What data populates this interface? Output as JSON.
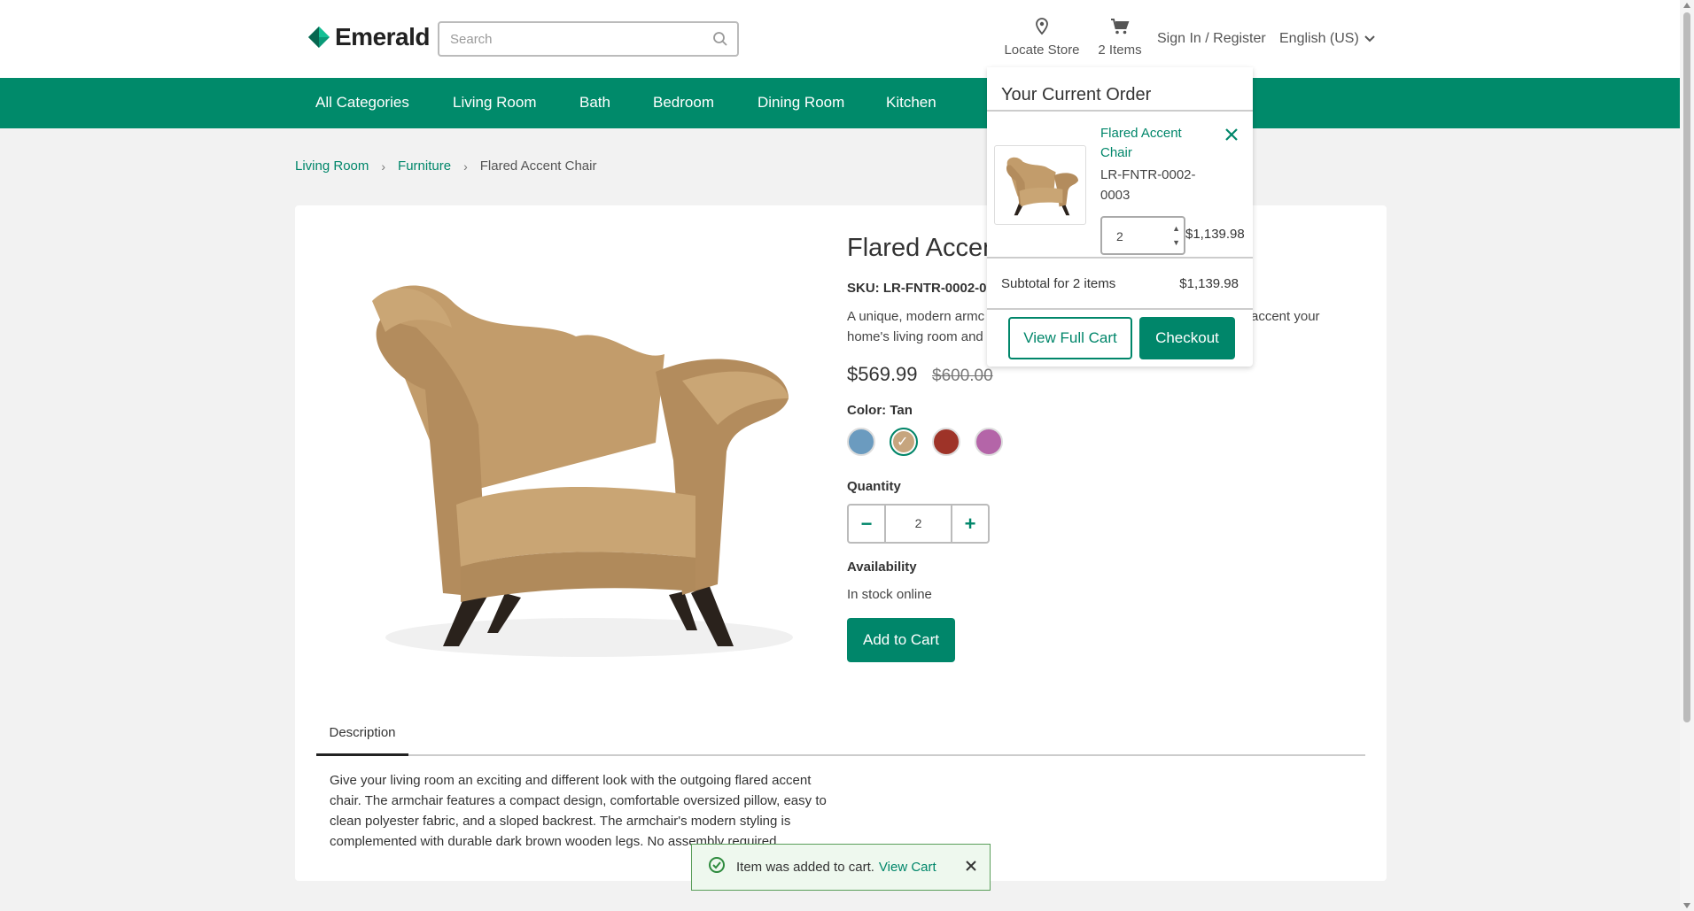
{
  "header": {
    "brand": "Emerald",
    "search_placeholder": "Search",
    "locate_store": "Locate Store",
    "cart_label": "2 Items",
    "sign_in": "Sign In / Register",
    "language": "English (US)"
  },
  "nav": {
    "items": [
      "All Categories",
      "Living Room",
      "Bath",
      "Bedroom",
      "Dining Room",
      "Kitchen"
    ]
  },
  "breadcrumb": {
    "items": [
      "Living Room",
      "Furniture",
      "Flared Accent Chair"
    ]
  },
  "product": {
    "title": "Flared Accen",
    "sku_label": "SKU: LR-FNTR-0002-00",
    "short_line1": "A unique, modern armc",
    "short_line1b": "accent your",
    "short_line2": "home's living room and",
    "price": "$569.99",
    "old_price": "$600.00",
    "color_label": "Color: Tan",
    "colors": [
      "#6b9bbf",
      "#c6a57e",
      "#9e3328",
      "#b465a8"
    ],
    "selected_color_index": 1,
    "quantity_label": "Quantity",
    "quantity": "2",
    "availability_label": "Availability",
    "availability": "In stock online",
    "add_to_cart": "Add to Cart",
    "tab_description": "Description",
    "description": "Give your living room an exciting and different look with the outgoing flared accent chair. The armchair features a compact design, comfortable oversized pillow, easy to clean polyester fabric, and a sloped backrest. The armchair's modern styling is complemented with durable dark brown wooden legs. No assembly required."
  },
  "cart_dropdown": {
    "title": "Your Current Order",
    "item_name": "Flared Accent Chair",
    "item_sku": "LR-FNTR-0002-0003",
    "item_qty": "2",
    "item_price": "$1,139.98",
    "subtotal_label": "Subtotal for 2 items",
    "subtotal_value": "$1,139.98",
    "view_cart": "View Full Cart",
    "checkout": "Checkout"
  },
  "toast": {
    "message": "Item was added to cart.",
    "link": "View Cart"
  },
  "colors": {
    "primary": "#00866a",
    "nav_bg": "#008a6a",
    "page_bg": "#f2f2f2"
  }
}
